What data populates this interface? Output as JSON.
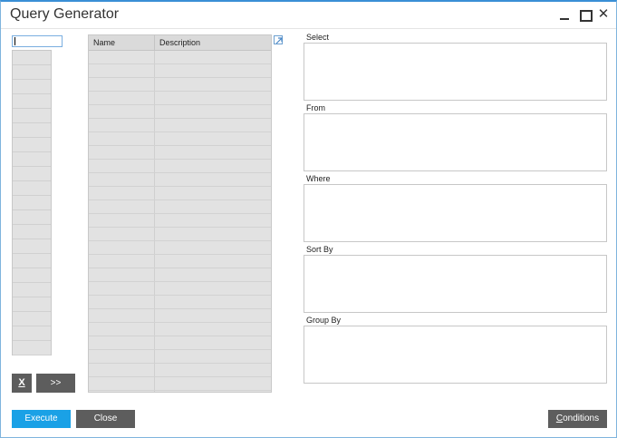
{
  "window": {
    "title": "Query Generator"
  },
  "left_panel": {
    "input_value": "",
    "row_count": 21,
    "clear_label": "X",
    "add_label": ">>"
  },
  "table": {
    "columns": [
      "Name",
      "Description"
    ],
    "row_count": 28
  },
  "sections": {
    "select": "Select",
    "from": "From",
    "where": "Where",
    "sort_by": "Sort By",
    "group_by": "Group By"
  },
  "footer": {
    "execute_label": "Execute",
    "close_label": "Close",
    "conditions_first": "C",
    "conditions_rest": "onditions"
  },
  "colors": {
    "accent": "#1aa1e6",
    "button_dark": "#5d5d5d",
    "title_border": "#3a8fd6"
  }
}
